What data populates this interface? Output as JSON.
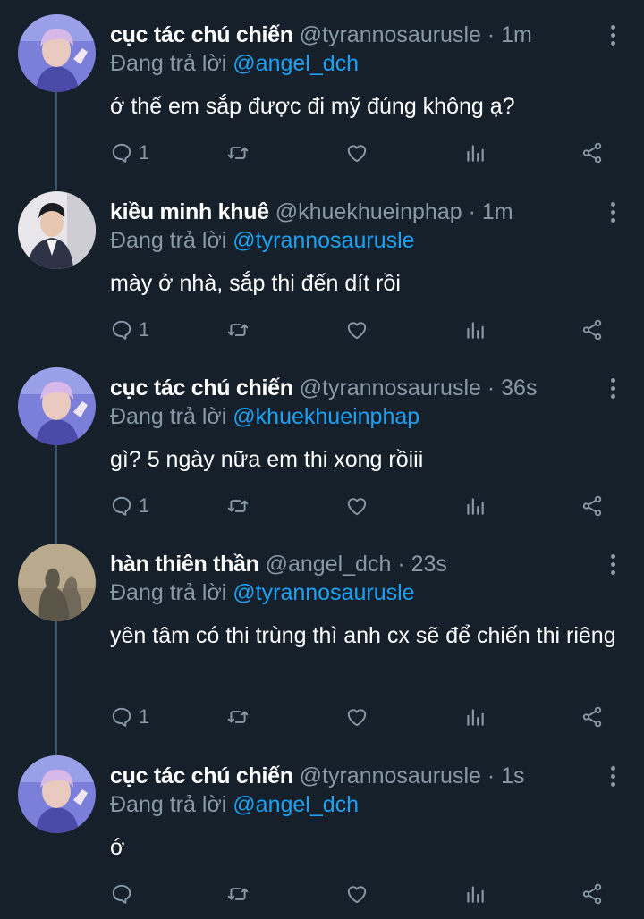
{
  "colors": {
    "background": "#15202b",
    "secondary_text": "#8899a6",
    "mention": "#1da1f2",
    "thread_line": "#3d5466"
  },
  "tweets": [
    {
      "name": "cục tác chú chiến",
      "handle": "@tyrannosaurusle",
      "dot": "·",
      "time": "1m",
      "reply_prefix": "Đang trả lời",
      "reply_to": "@angel_dch",
      "text": "ớ thế em sắp được đi mỹ đúng không ạ?",
      "reply_count": "1",
      "avatar": "avatar-purple-hair"
    },
    {
      "name": "kiều minh khuê",
      "handle": "@khuekhueinphap",
      "dot": "·",
      "time": "1m",
      "reply_prefix": "Đang trả lời",
      "reply_to": "@tyrannosaurusle",
      "text": "mày ở nhà, sắp thi đến dít rồi",
      "reply_count": "1",
      "avatar": "avatar-suit-man"
    },
    {
      "name": "cục tác chú chiến",
      "handle": "@tyrannosaurusle",
      "dot": "·",
      "time": "36s",
      "reply_prefix": "Đang trả lời",
      "reply_to": "@khuekhueinphap",
      "text": "gì? 5 ngày nữa em thi xong rồiii",
      "reply_count": "1",
      "avatar": "avatar-purple-hair"
    },
    {
      "name": "hàn thiên thần",
      "handle": "@angel_dch",
      "dot": "·",
      "time": "23s",
      "reply_prefix": "Đang trả lời",
      "reply_to": "@tyrannosaurusle",
      "text": "yên tâm có thi trùng thì anh cx sẽ để chiến thi riêng",
      "reply_count": "1",
      "avatar": "avatar-shadow"
    },
    {
      "name": "cục tác chú chiến",
      "handle": "@tyrannosaurusle",
      "dot": "·",
      "time": "1s",
      "reply_prefix": "Đang trả lời",
      "reply_to": "@angel_dch",
      "text": "ớ",
      "reply_count": "",
      "avatar": "avatar-purple-hair"
    }
  ],
  "icons": [
    "reply-icon",
    "retweet-icon",
    "like-icon",
    "analytics-icon",
    "share-icon",
    "more-options-icon"
  ]
}
